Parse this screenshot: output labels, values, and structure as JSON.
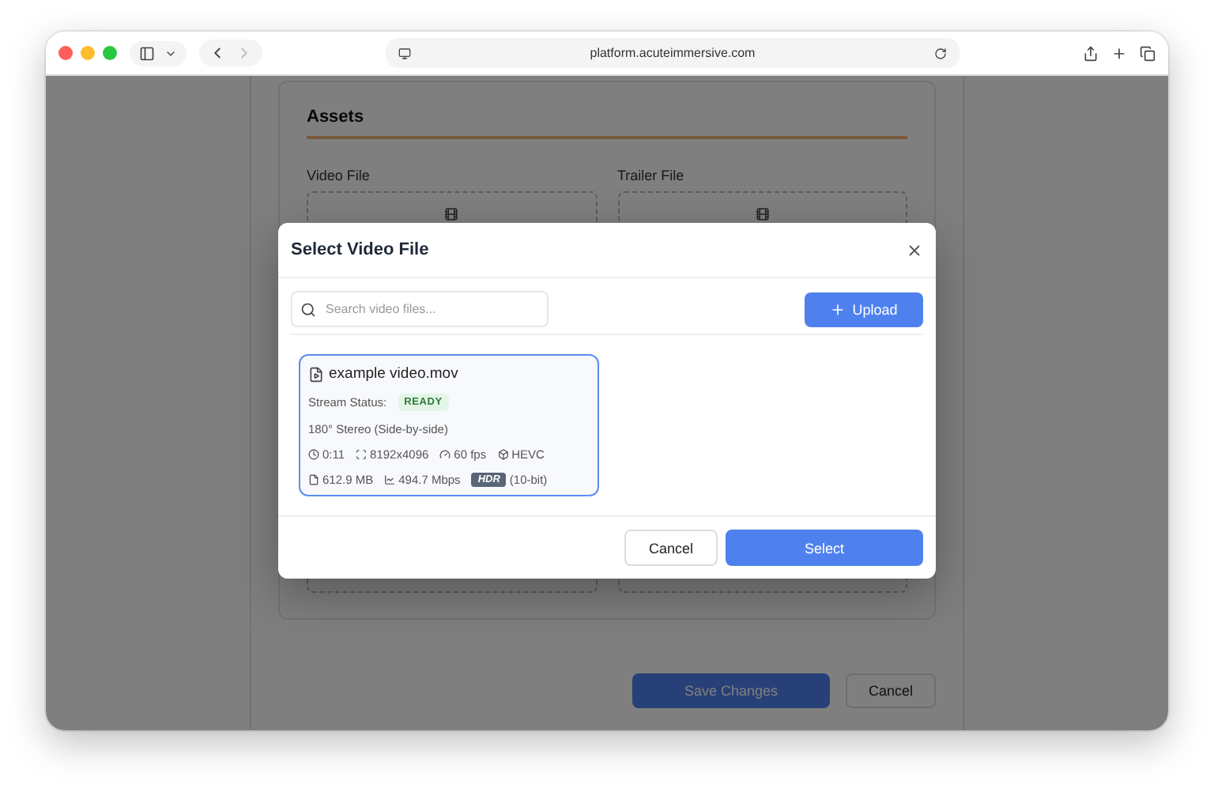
{
  "browser": {
    "url": "platform.acuteimmersive.com"
  },
  "page": {
    "section_title": "Assets",
    "fields": [
      {
        "label": "Video File"
      },
      {
        "label": "Trailer File"
      }
    ],
    "buttons": [
      {
        "label": "Save Changes",
        "kind": "primary"
      },
      {
        "label": "Cancel",
        "kind": "secondary"
      }
    ]
  },
  "dialog": {
    "title": "Select Video File",
    "search": {
      "placeholder": "Search video files..."
    },
    "upload_button": "Upload",
    "files": [
      {
        "name": "example video.mov",
        "selected": true,
        "status_label": "Stream Status:",
        "status": "READY",
        "projection": "180° Stereo (Side-by-side)",
        "duration": "0:11",
        "resolution": "8192x4096",
        "fps": "60 fps",
        "codec": "HEVC",
        "size": "612.9 MB",
        "bitrate": "494.7 Mbps",
        "hdr_badge": "HDR",
        "bit_depth": "(10-bit)"
      }
    ],
    "buttons": [
      {
        "label": "Cancel",
        "kind": "secondary"
      },
      {
        "label": "Select",
        "kind": "primary"
      }
    ]
  }
}
